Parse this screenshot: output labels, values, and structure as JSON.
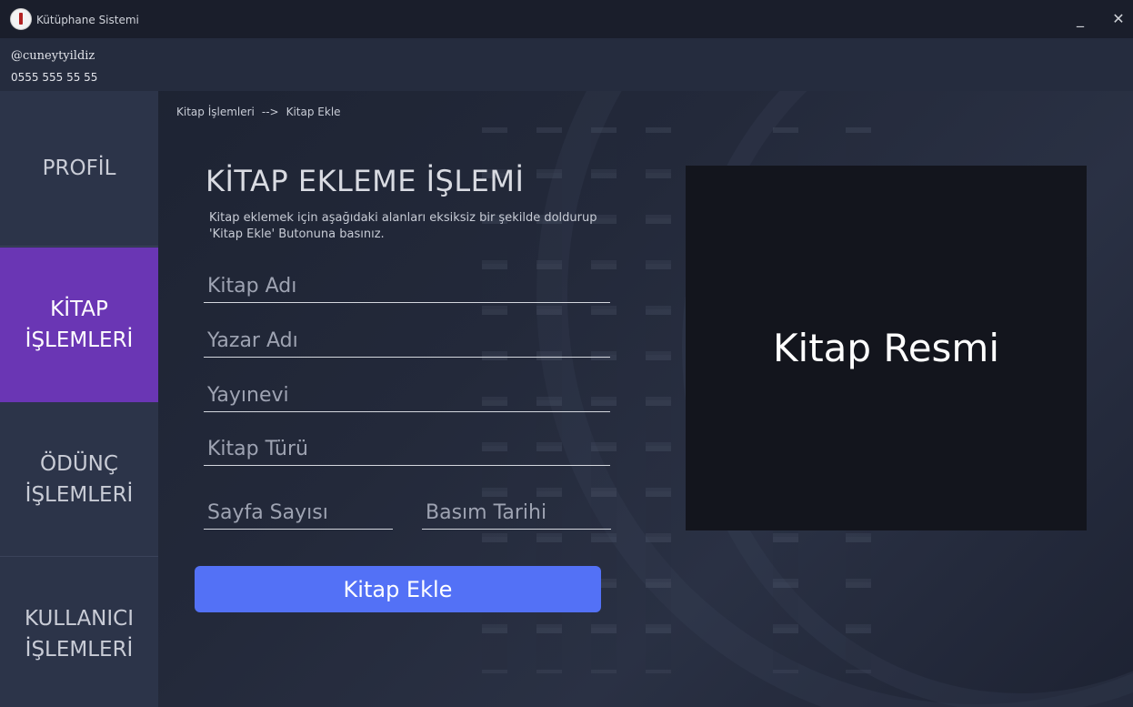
{
  "window": {
    "title": "Kütüphane Sistemi",
    "minimize_label": "_",
    "close_label": "✕",
    "logo_icon": "library-logo-icon"
  },
  "user": {
    "handle": "@cuneytyildiz",
    "phone": "0555 555 55 55"
  },
  "sidebar": {
    "items": [
      {
        "label": "PROFİL",
        "active": false
      },
      {
        "label": "KİTAP\nİŞLEMLERİ",
        "active": true
      },
      {
        "label": "ÖDÜNÇ\nİŞLEMLERİ",
        "active": false
      },
      {
        "label": "KULLANICI\nİŞLEMLERİ",
        "active": false
      }
    ],
    "active_color": "#6a36b4"
  },
  "breadcrumb": {
    "parent": "Kitap İşlemleri",
    "separator": "-->",
    "current": "Kitap Ekle"
  },
  "form": {
    "title": "KİTAP EKLEME İŞLEMİ",
    "description": "Kitap eklemek için aşağıdaki alanları eksiksiz bir şekilde doldurup 'Kitap Ekle' Butonuna basınız.",
    "fields": {
      "book_name": {
        "placeholder": "Kitap Adı",
        "value": ""
      },
      "author_name": {
        "placeholder": "Yazar Adı",
        "value": ""
      },
      "publisher": {
        "placeholder": "Yayınevi",
        "value": ""
      },
      "book_type": {
        "placeholder": "Kitap Türü",
        "value": ""
      },
      "page_count": {
        "placeholder": "Sayfa Sayısı",
        "value": ""
      },
      "print_date": {
        "placeholder": "Basım Tarihi",
        "value": ""
      }
    },
    "submit_label": "Kitap Ekle",
    "submit_color": "#5371f6"
  },
  "image_panel": {
    "label": "Kitap Resmi"
  }
}
